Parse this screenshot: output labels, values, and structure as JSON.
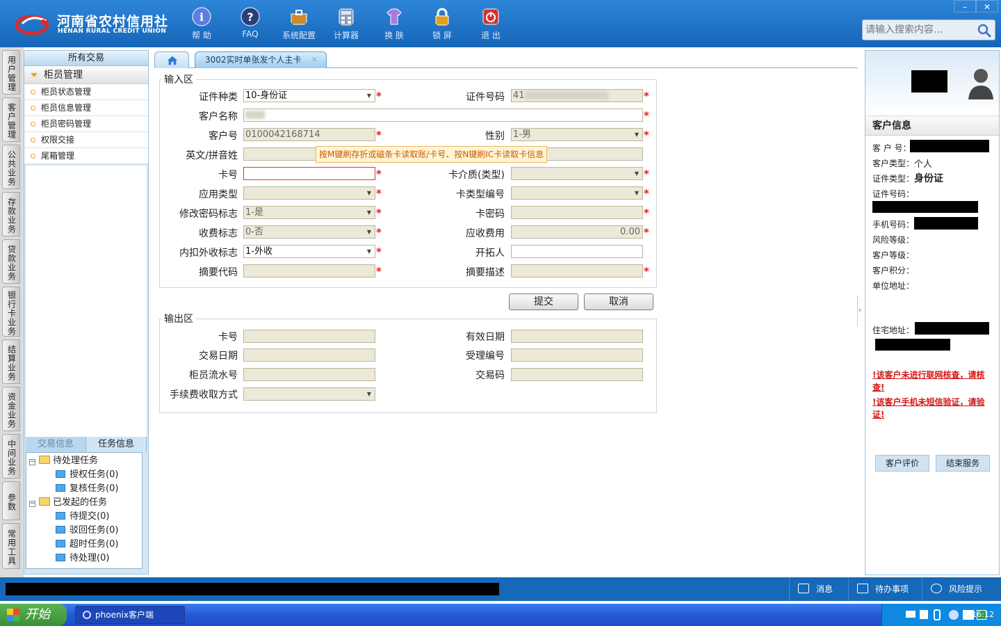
{
  "brand": {
    "name_cn": "河南省农村信用社",
    "name_en": "HENAN RURAL CREDIT UNION"
  },
  "toolbar": [
    {
      "label": "帮 助",
      "icon": "info-icon",
      "color": "#4a6fd8"
    },
    {
      "label": "FAQ",
      "icon": "question-icon",
      "color": "#2a3f7a"
    },
    {
      "label": "系统配置",
      "icon": "toolbox-icon",
      "color": "#d08a2a"
    },
    {
      "label": "计算器",
      "icon": "calculator-icon",
      "color": "#7a8fa8"
    },
    {
      "label": "换 肤",
      "icon": "shirt-icon",
      "color": "#9a6cd8"
    },
    {
      "label": "锁 屏",
      "icon": "lock-icon",
      "color": "#e0a020"
    },
    {
      "label": "退 出",
      "icon": "power-icon",
      "color": "#d83030"
    }
  ],
  "window_controls": {
    "minimize": "–",
    "close": "✕"
  },
  "search": {
    "placeholder": "请输入搜索内容..."
  },
  "left_tabs": [
    "用户管理",
    "客户管理",
    "公共业务",
    "存款业务",
    "贷款业务",
    "银行卡业务",
    "结算业务",
    "资金业务",
    "中间业务",
    "参数",
    "常用工具"
  ],
  "sidebar": {
    "all_label": "所有交易",
    "group_label": "柜员管理",
    "items": [
      "柜员状态管理",
      "柜员信息管理",
      "柜员密码管理",
      "权限交接",
      "尾箱管理"
    ],
    "bottom_tabs": [
      "交易信息",
      "任务信息"
    ],
    "tree": {
      "pending": "待处理任务",
      "auth": "授权任务(0)",
      "review": "复核任务(0)",
      "initiated": "已发起的任务",
      "to_submit": "待提交(0)",
      "rejected": "驳回任务(0)",
      "timeout": "超时任务(0)",
      "to_process": "待处理(0)"
    }
  },
  "tabs": {
    "active": "3002实时单张发个人主卡",
    "close": "✕"
  },
  "input_section": {
    "legend": "输入区",
    "labels": {
      "id_type": "证件种类",
      "id_number": "证件号码",
      "customer_name": "客户名称",
      "customer_no": "客户号",
      "gender": "性别",
      "english_name": "英文/拼音姓",
      "card_no": "卡号",
      "card_medium": "卡介质(类型)",
      "app_type": "应用类型",
      "card_type_no": "卡类型编号",
      "change_pwd_flag": "修改密码标志",
      "card_pwd": "卡密码",
      "fee_flag": "收费标志",
      "fee_due": "应收费用",
      "deduct_flag": "内扣外收标志",
      "developer": "开拓人",
      "summary_code": "摘要代码",
      "summary_desc": "摘要描述"
    },
    "values": {
      "id_type": "10-身份证",
      "id_number": "41",
      "customer_no": "0100042168714",
      "gender": "1-男",
      "change_pwd_flag": "1-是",
      "fee_flag": "0-否",
      "fee_due": "0.00",
      "deduct_flag": "1-外收"
    },
    "tooltip": "按M键刷存折或磁条卡读取账/卡号、按N键刷IC卡读取卡信息"
  },
  "buttons": {
    "submit": "提交",
    "cancel": "取消"
  },
  "output_section": {
    "legend": "输出区",
    "labels": {
      "card_no": "卡号",
      "expiry": "有效日期",
      "trade_date": "交易日期",
      "accept_no": "受理编号",
      "teller_serial": "柜员流水号",
      "trade_code": "交易码",
      "fee_method": "手续费收取方式"
    }
  },
  "right_panel": {
    "title": "客户信息",
    "fields": {
      "customer_no": "客 户 号：",
      "customer_type": "客户类型：",
      "customer_type_value": "个人",
      "id_type": "证件类型：",
      "id_type_value": "身份证",
      "id_number": "证件号码：",
      "phone": "手机号码：",
      "risk_level": "风险等级：",
      "customer_level": "客户等级：",
      "points": "客户积分：",
      "work_address": "单位地址：",
      "home_address": "住宅地址："
    },
    "warnings": [
      "!该客户未进行联网核查，请核查!",
      "!该客户手机未短信验证，请验证!"
    ],
    "buttons": {
      "evaluate": "客户评价",
      "end_service": "结束服务"
    }
  },
  "status_bar": {
    "messages": "消息",
    "todo": "待办事项",
    "risk": "风险提示"
  },
  "taskbar": {
    "start": "开始",
    "app": "phoenix客户端",
    "clock": "16:12"
  },
  "colors": {
    "header": "#1e73c8",
    "required": "#e02020",
    "warning": "#d41818"
  }
}
